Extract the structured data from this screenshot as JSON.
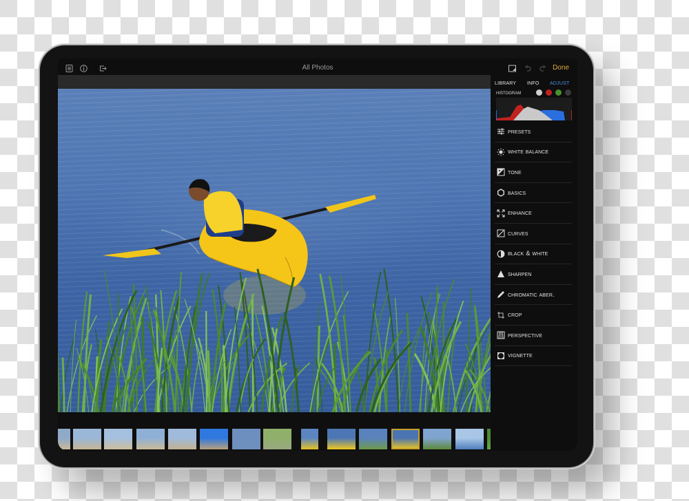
{
  "topbar": {
    "title": "All Photos",
    "left_icons": [
      "document-list-icon",
      "info-icon",
      "export-icon"
    ],
    "right_icons": [
      "compare-icon",
      "undo-icon",
      "redo-icon"
    ],
    "done_label": "Done"
  },
  "panel": {
    "tabs": [
      {
        "label": "Library",
        "active": false
      },
      {
        "label": "Info",
        "active": false
      },
      {
        "label": "Adjust",
        "active": true
      }
    ],
    "histogram": {
      "label": "Histogram",
      "channels": [
        {
          "name": "luminance",
          "color": "#cfcfcf"
        },
        {
          "name": "red",
          "color": "#c0221f"
        },
        {
          "name": "green",
          "color": "#4a8f2e"
        },
        {
          "name": "all",
          "color": "#3a3a3a"
        }
      ]
    },
    "menu": [
      {
        "label": "Presets",
        "icon": "sliders-icon"
      },
      {
        "label": "White Balance",
        "icon": "sun-icon"
      },
      {
        "label": "Tone",
        "icon": "tone-icon"
      },
      {
        "label": "Basics",
        "icon": "hexagon-icon"
      },
      {
        "label": "Enhance",
        "icon": "expand-arrows-icon"
      },
      {
        "label": "Curves",
        "icon": "curve-icon"
      },
      {
        "label": "Black & White",
        "icon": "half-circle-icon"
      },
      {
        "label": "Sharpen",
        "icon": "triangle-icon"
      },
      {
        "label": "Chromatic Aber.",
        "icon": "pencil-icon"
      },
      {
        "label": "Crop",
        "icon": "crop-icon"
      },
      {
        "label": "Perspective",
        "icon": "perspective-icon"
      },
      {
        "label": "Vignette",
        "icon": "vignette-icon"
      }
    ]
  },
  "filmstrip": {
    "thumbnails": [
      {
        "subject": "beach",
        "selected": false
      },
      {
        "subject": "beach-kids",
        "selected": false
      },
      {
        "subject": "beach-kid-crouching",
        "selected": false
      },
      {
        "subject": "beach-kid-standing",
        "selected": false
      },
      {
        "subject": "beach-people",
        "selected": false
      },
      {
        "subject": "blue-frisbee",
        "selected": false
      },
      {
        "subject": "paddleboard",
        "selected": false
      },
      {
        "subject": "sailboat-shore",
        "selected": false
      },
      {
        "subject": "kayak-closeup",
        "selected": false
      },
      {
        "subject": "yellow-kayak",
        "selected": false
      },
      {
        "subject": "kayakers-group",
        "selected": false
      },
      {
        "subject": "yellow-kayak-water",
        "selected": true
      },
      {
        "subject": "lake-boats",
        "selected": false
      },
      {
        "subject": "sailboat-lake",
        "selected": false
      },
      {
        "subject": "green-shore",
        "selected": false
      }
    ]
  },
  "colors": {
    "accent": "#4a8fe0",
    "done": "#e2a93a",
    "selection": "#c9a227"
  }
}
